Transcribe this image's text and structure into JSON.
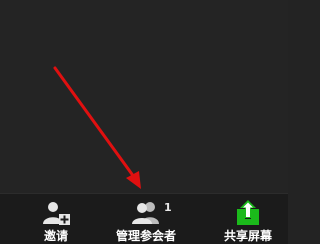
{
  "toolbar": {
    "invite_label": "邀请",
    "participants_label": "管理参会者",
    "participants_count": "1",
    "share_label": "共享屏幕"
  },
  "colors": {
    "background": "#232323",
    "toolbar": "#1b1b1b",
    "icon_white": "#e6e6e6",
    "share_green": "#1bba1b",
    "annotation_red": "#e01010"
  },
  "icons": {
    "invite": "user-plus-icon",
    "participants": "users-icon",
    "share": "share-screen-up-arrow-icon"
  }
}
